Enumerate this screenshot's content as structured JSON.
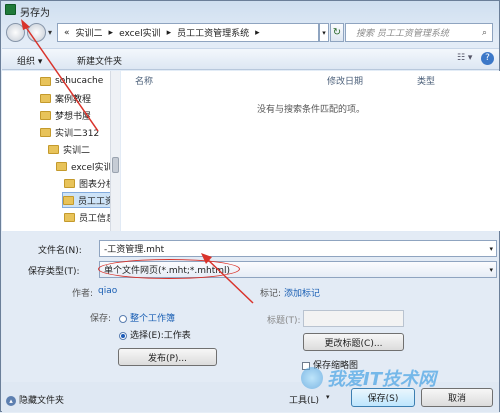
{
  "window": {
    "title": "另存为"
  },
  "address": {
    "crumbs": [
      "实训二",
      "excel实训",
      "员工工资管理系统"
    ],
    "prefix": "«"
  },
  "search": {
    "placeholder": "搜索 员工工资管理系统"
  },
  "toolbar": {
    "organize": "组织 ▾",
    "new_folder": "新建文件夹"
  },
  "nav": {
    "items": [
      {
        "label": "sohucache"
      },
      {
        "label": "案例教程"
      },
      {
        "label": "梦想书屋"
      },
      {
        "label": "实训二312"
      },
      {
        "label": "实训二"
      },
      {
        "label": "excel实训"
      },
      {
        "label": "图表分析"
      },
      {
        "label": "员工工资"
      },
      {
        "label": "员工信息"
      }
    ]
  },
  "list": {
    "columns": [
      "名称",
      "修改日期",
      "类型"
    ],
    "empty_text": "没有与搜索条件匹配的项。"
  },
  "form": {
    "filename_label": "文件名(N):",
    "filename_value": "-工资管理.mht",
    "type_label": "保存类型(T):",
    "type_value": "单个文件网页(*.mht;*.mhtml)",
    "author_label": "作者:",
    "author_value": "qiao",
    "tags_label": "标记:",
    "tags_link": "添加标记",
    "save_label": "保存:",
    "radio_workbook": "整个工作簿",
    "radio_sheet": "选择(E):工作表",
    "title_label": "标题(T):",
    "change_title": "更改标题(C)...",
    "publish": "发布(P)...",
    "thumbnail": "保存缩略图"
  },
  "footer": {
    "hide_folders": "隐藏文件夹",
    "tools": "工具(L)",
    "save": "保存(S)",
    "cancel": "取消"
  },
  "watermark": {
    "text": "我爱IT技术网"
  }
}
